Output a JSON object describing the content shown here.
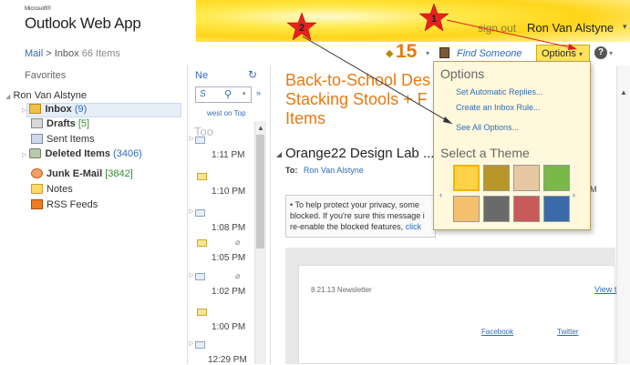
{
  "header": {
    "logo_small": "Microsoft®",
    "logo": "Outlook Web App",
    "sign_out": "sign out",
    "user_name": "Ron Van Alstyne"
  },
  "breadcrumb": {
    "root": "Mail",
    "separator": ">",
    "folder": "Inbox",
    "count": "66 Items"
  },
  "toolbar": {
    "reminder_count": "15",
    "find_someone": "Find Someone",
    "options_label": "Options",
    "help_label": "?"
  },
  "folder_pane": {
    "favorites_label": "Favorites",
    "mailbox": "Ron Van Alstyne",
    "folders": [
      {
        "name": "Inbox",
        "count": "(9)",
        "count_color": "blue"
      },
      {
        "name": "Drafts",
        "count": "[5]",
        "count_color": "green"
      },
      {
        "name": "Sent Items",
        "count": ""
      },
      {
        "name": "Deleted Items",
        "count": "(3406)",
        "count_color": "blue"
      },
      {
        "name": "Junk E-Mail",
        "count": "[3842]",
        "count_color": "green"
      },
      {
        "name": "Notes",
        "count": ""
      },
      {
        "name": "RSS Feeds",
        "count": ""
      }
    ]
  },
  "message_list": {
    "new_label": "Ne",
    "search_placeholder": "S",
    "sort_label": "west on Top",
    "group_header": "Too",
    "rows": [
      {
        "time": "1:11 PM",
        "icon": "read",
        "attachment": false
      },
      {
        "time": "1:10 PM",
        "icon": "unread",
        "attachment": false
      },
      {
        "time": "1:08 PM",
        "icon": "read",
        "attachment": false
      },
      {
        "time": "1:05 PM",
        "icon": "unread",
        "attachment": true
      },
      {
        "time": "1:02 PM",
        "icon": "read",
        "attachment": true
      },
      {
        "time": "1:00 PM",
        "icon": "unread",
        "attachment": false
      },
      {
        "time": "12:29 PM",
        "icon": "read",
        "attachment": false
      }
    ]
  },
  "reading_pane": {
    "subject_line1": "Back-to-School Des",
    "subject_line2": "Stacking Stools + F",
    "subject_line3": "Items",
    "sender": "Orange22 Design Lab ...",
    "to_label": "To:",
    "to_value": "Ron Van Alstyne",
    "privacy_text_1": "• To help protect your privacy, some",
    "privacy_text_2": "blocked. If you're sure this message i",
    "privacy_text_3": "re-enable the blocked features,",
    "privacy_link": "click",
    "time_fragment": "PM",
    "newsletter_date": "8.21.13 Newsletter",
    "newsletter_view": "View t",
    "newsletter_facebook": "Facebook",
    "newsletter_twitter": "Twitter"
  },
  "options_menu": {
    "title": "Options",
    "items": [
      "Set Automatic Replies...",
      "Create an Inbox Rule...",
      "See All Options..."
    ],
    "theme_title": "Select a Theme",
    "theme_colors": [
      "#ffd24a",
      "#b8962a",
      "#e8c8a0",
      "#7ab848",
      "#f4c070",
      "#6a6a6a",
      "#c85a5a",
      "#3a6aa8"
    ]
  },
  "annotations": {
    "star1": "1",
    "star2": "2"
  }
}
